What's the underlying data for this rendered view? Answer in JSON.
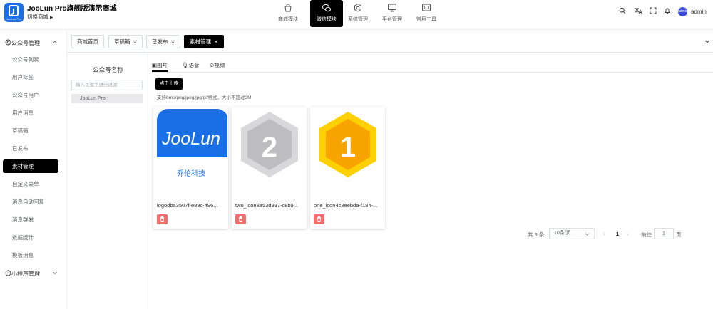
{
  "header": {
    "app_title": "JooLun Pro旗舰版演示商城",
    "switch_label": "切换商城",
    "logo_text": "JooLun Pro",
    "nav": [
      {
        "label": "商城模块",
        "icon": "shopping-bag-icon"
      },
      {
        "label": "微信模块",
        "icon": "wechat-icon",
        "active": true
      },
      {
        "label": "系统管理",
        "icon": "gear-icon"
      },
      {
        "label": "平台管理",
        "icon": "monitor-icon"
      },
      {
        "label": "常用工具",
        "icon": "code-window-icon"
      }
    ],
    "username": "admin",
    "avatar_text": "admin"
  },
  "sidebar": {
    "groups": [
      {
        "label": "公众号管理",
        "expanded": true
      },
      {
        "label": "小程序管理",
        "expanded": false
      }
    ],
    "items": [
      {
        "label": "公众号列表"
      },
      {
        "label": "用户标签"
      },
      {
        "label": "公众号用户"
      },
      {
        "label": "用户消息"
      },
      {
        "label": "草稿箱"
      },
      {
        "label": "已发布"
      },
      {
        "label": "素材管理",
        "active": true
      },
      {
        "label": "自定义菜单"
      },
      {
        "label": "消息自动回复"
      },
      {
        "label": "消息群发"
      },
      {
        "label": "数据统计"
      },
      {
        "label": "模板消息"
      }
    ]
  },
  "tabs": [
    {
      "label": "商城首页",
      "closable": false
    },
    {
      "label": "草稿箱",
      "closable": true
    },
    {
      "label": "已发布",
      "closable": true
    },
    {
      "label": "素材管理",
      "closable": true,
      "active": true
    }
  ],
  "account_panel": {
    "title": "公众号名称",
    "search_placeholder": "输入关键字进行过滤",
    "accounts": [
      "JooLun Pro"
    ]
  },
  "media_tabs": [
    {
      "label": "图片",
      "active": true
    },
    {
      "label": "语音"
    },
    {
      "label": "视频"
    }
  ],
  "upload": {
    "button_label": "点击上传",
    "hint": "支持bmp/png/jpeg/jpg/gif格式，大小不超过2M"
  },
  "images": [
    {
      "filename": "logodba3507f-e89c-496...",
      "thumb_text": "JooLun",
      "thumb_subtext": "乔伦科技"
    },
    {
      "filename": "two_icon8a53d997-c8b9...",
      "thumb_text": "2"
    },
    {
      "filename": "one_icon4c8eebda-f184-...",
      "thumb_text": "1"
    }
  ],
  "pagination": {
    "total_label": "共 3 条",
    "page_size_label": "10条/页",
    "current_page": "1",
    "goto_label": "前往",
    "goto_value": "1",
    "page_suffix": "页"
  },
  "colors": {
    "accent": "#000000",
    "danger": "#f56c6c",
    "logo_blue": "#1a6fe6"
  }
}
